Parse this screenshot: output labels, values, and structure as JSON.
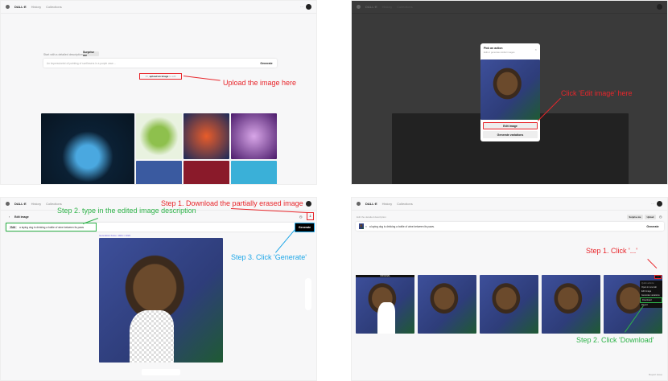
{
  "nav": {
    "brand": "DALL·E",
    "history": "History",
    "collections": "Collections"
  },
  "p1": {
    "prompt_label": "Start with a detailed description",
    "surprise": "Surprise me",
    "placeholder": "An Impressionist oil painting of sunflowers in a purple vase…",
    "generate": "Generate",
    "upload_prefix": "Or,",
    "upload_link": "upload an image",
    "upload_suffix": "to edit",
    "annotation": "Upload the image here"
  },
  "p2": {
    "modal_title": "Pick an action",
    "modal_sub": "Edit or generate similar images",
    "edit": "Edit image",
    "variations": "Generate variations",
    "annotation": "Click 'Edit image' here"
  },
  "p3": {
    "title": "Edit image",
    "edit_tag": "Edit",
    "prompt": "a laying dog is drinking a bottle of wine between its paws",
    "generate": "Generate",
    "frame": "Generation frame: 1024 × 1024",
    "step1": "Step 1. Download the partially erased image",
    "step2": "Step 2. type in the edited image description",
    "step3": "Step 3. Click 'Generate'"
  },
  "p4": {
    "label": "Edit the detailed description",
    "surprise": "Surprise me",
    "upload": "Upload",
    "prompt": "a laying dog is drinking a bottle of wine between its paws.",
    "generate": "Generate",
    "original": "ORIGINAL",
    "menu": [
      "Quick actions",
      "Open in new tab",
      "Edit image",
      "Generate variations",
      "Download",
      "Report"
    ],
    "report": "Report issue",
    "step1": "Step 1. Click '...'",
    "step2": "Step 2. Click 'Download'"
  },
  "colors": {
    "annotation_red": "#e8262b",
    "annotation_green": "#2fb34a",
    "annotation_blue": "#1ea7e8"
  }
}
